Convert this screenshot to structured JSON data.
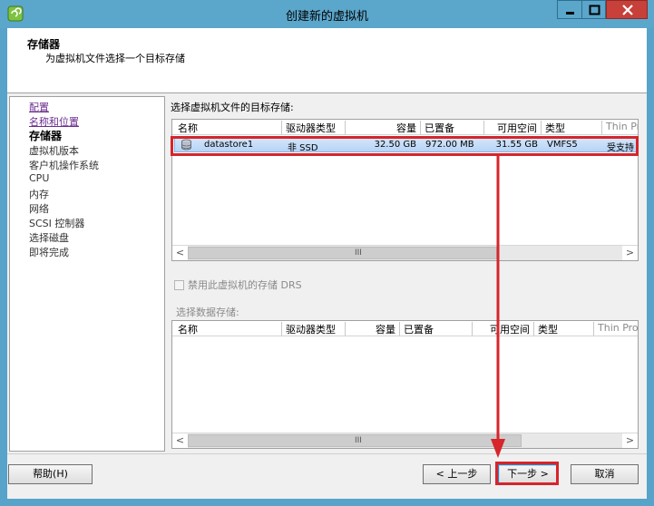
{
  "window": {
    "title": "创建新的虚拟机"
  },
  "header": {
    "title": "存储器",
    "subtitle": "为虚拟机文件选择一个目标存储"
  },
  "nav": {
    "items": [
      {
        "label": "配置",
        "state": "link"
      },
      {
        "label": "名称和位置",
        "state": "link"
      },
      {
        "label": "存储器",
        "state": "current"
      },
      {
        "label": "虚拟机版本",
        "state": "pending"
      },
      {
        "label": "客户机操作系统",
        "state": "pending"
      },
      {
        "label": "CPU",
        "state": "pending"
      },
      {
        "label": "内存",
        "state": "pending"
      },
      {
        "label": "网络",
        "state": "pending"
      },
      {
        "label": "SCSI 控制器",
        "state": "pending"
      },
      {
        "label": "选择磁盘",
        "state": "pending"
      },
      {
        "label": "即将完成",
        "state": "pending"
      }
    ]
  },
  "storage": {
    "label": "选择虚拟机文件的目标存储:",
    "columns": [
      "名称",
      "驱动器类型",
      "容量",
      "已置备",
      "可用空间",
      "类型",
      "Thin Pr"
    ],
    "rows": [
      {
        "name": "datastore1",
        "drive_type": "非 SSD",
        "capacity": "32.50 GB",
        "provisioned": "972.00 MB",
        "free": "31.55 GB",
        "type": "VMFS5",
        "thin": "受支持"
      }
    ],
    "scroll_grip": "III"
  },
  "drs": {
    "label": "禁用此虚拟机的存储 DRS",
    "checked": false
  },
  "datastore": {
    "label": "选择数据存储:",
    "columns": [
      "名称",
      "驱动器类型",
      "容量",
      "已置备",
      "可用空间",
      "类型",
      "Thin Pro"
    ],
    "scroll_grip": "III"
  },
  "buttons": {
    "help": "帮助(H)",
    "back": "< 上一步",
    "next": "下一步 >",
    "cancel": "取消"
  },
  "colors": {
    "title_bar": "#5ba6cb",
    "close_button": "#c7403a",
    "annotation": "#d6252b",
    "link": "#6b2e8f"
  }
}
